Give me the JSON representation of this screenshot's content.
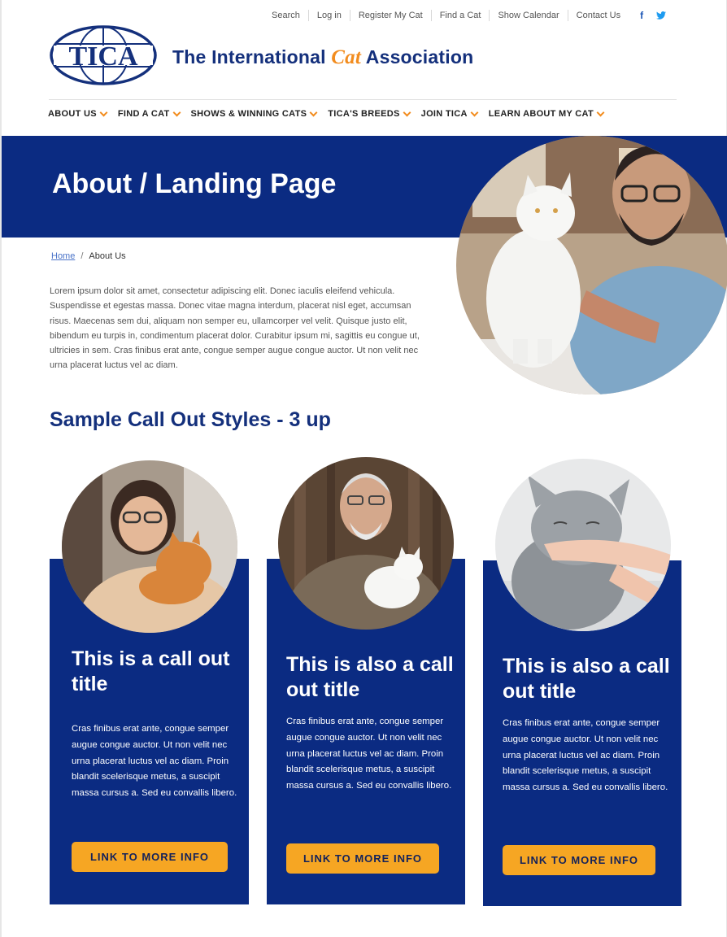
{
  "utility_nav": [
    "Search",
    "Log in",
    "Register My Cat",
    "Find a Cat",
    "Show Calendar",
    "Contact Us"
  ],
  "social": {
    "facebook": "f",
    "twitter": "twitter-icon"
  },
  "logo_text": "TICA",
  "brand": {
    "before": "The International ",
    "cat": "Cat",
    "after": " Association"
  },
  "main_nav": [
    "ABOUT US",
    "FIND A CAT",
    "SHOWS & WINNING CATS",
    "TICA'S BREEDS",
    "JOIN TICA",
    "LEARN ABOUT MY CAT"
  ],
  "hero": {
    "title": "About / Landing Page"
  },
  "breadcrumb": {
    "home": "Home",
    "separator": "/",
    "current": "About Us"
  },
  "intro": "Lorem ipsum dolor sit amet, consectetur adipiscing elit. Donec iaculis eleifend vehicula. Suspendisse et egestas massa. Donec vitae magna interdum, placerat nisl eget, accumsan risus. Maecenas sem dui, aliquam non semper eu, ullamcorper vel velit. Quisque justo elit, bibendum eu turpis in, condimentum placerat dolor. Curabitur ipsum mi, sagittis eu congue ut, ultricies in sem. Cras finibus erat ante, congue semper augue congue auctor. Ut non velit nec urna placerat luctus vel ac diam.",
  "section_title": "Sample Call Out Styles  - 3 up",
  "cards": [
    {
      "title": "This is a call out title",
      "body": "Cras finibus erat ante, congue semper augue congue auctor. Ut non velit nec urna placerat luctus vel ac diam. Proin blandit scelerisque metus, a suscipit massa cursus a. Sed eu convallis libero.",
      "button": "LINK TO MORE INFO"
    },
    {
      "title": "This is also a call out title",
      "body": "Cras finibus erat ante, congue semper augue congue auctor. Ut non velit nec urna placerat luctus vel ac diam. Proin blandit scelerisque metus, a suscipit massa cursus a. Sed eu convallis libero.",
      "button": "LINK TO MORE INFO"
    },
    {
      "title": "This is also a call out title",
      "body": "Cras finibus erat ante, congue semper augue congue auctor. Ut non velit nec urna placerat luctus vel ac diam. Proin blandit scelerisque metus, a suscipit massa cursus a. Sed eu convallis libero.",
      "button": "LINK TO MORE INFO"
    }
  ],
  "colors": {
    "brand_blue": "#0b2b82",
    "accent_orange": "#f28c1e",
    "button_orange": "#f6a623"
  }
}
